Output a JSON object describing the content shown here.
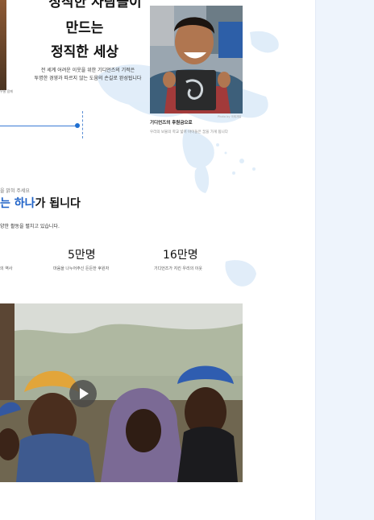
{
  "hero": {
    "line1": "정직한 사람들이",
    "line2": "만드는",
    "line3": "정직한 세상",
    "desc1": "전 세계 어려운 이웃을 위한 기디언즈의 기적은",
    "desc2": "투명한 경영과 따르지 않는 도움의 손길로 완성됩니다"
  },
  "left_card": {
    "caption": "우물 함께"
  },
  "photo_card": {
    "caption": "기디언즈의 후원금으로",
    "subcaption": "우리의 보물의 학교 넓어 아이들은 꿈을 가게 됩니다",
    "credit": "Photo by 국제개발"
  },
  "section": {
    "eyebrow": "을 밝혀 주세요",
    "title_accent": "는 하나",
    "title_rest": "가 됩니다",
    "desc": "양한 활동을 펼치고 있습니다."
  },
  "stats": [
    {
      "value": "",
      "caption": "의 역사"
    },
    {
      "value": "5만명",
      "caption": "마음을 나누어주신 든든한 후원자"
    },
    {
      "value": "16만명",
      "caption": "기디언즈가 지킨 우리의 이웃"
    }
  ],
  "colors": {
    "accent": "#1f62c7",
    "panel": "#eef4fc"
  }
}
